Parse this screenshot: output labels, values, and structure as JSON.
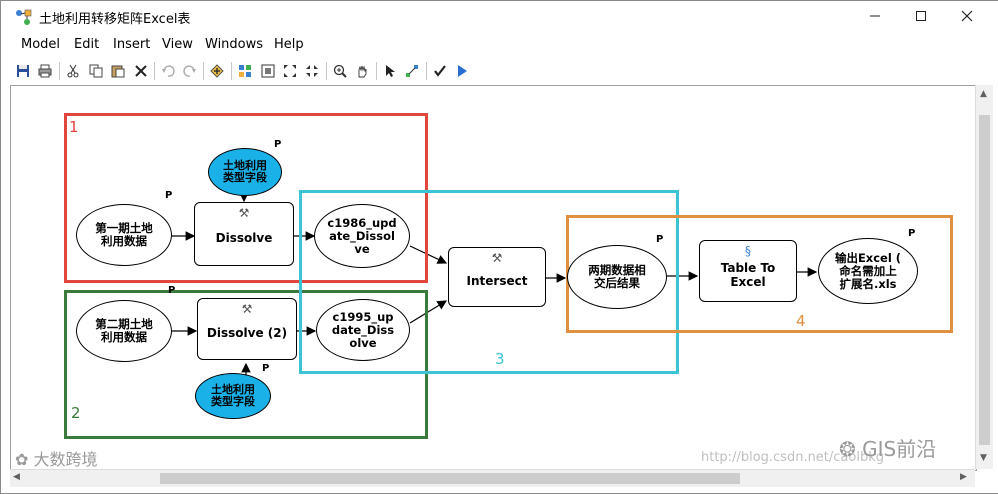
{
  "window": {
    "title": "土地利用转移矩阵Excel表",
    "minimize_icon": "minimize-icon",
    "maximize_icon": "maximize-icon",
    "close_icon": "close-icon"
  },
  "menu": [
    "Model",
    "Edit",
    "Insert",
    "View",
    "Windows",
    "Help"
  ],
  "toolbar": [
    "save-icon",
    "print-icon",
    "cut-icon",
    "copy-icon",
    "paste-icon",
    "delete-icon",
    "undo-icon",
    "redo-icon",
    "add-data-icon",
    "auto-layout-icon",
    "full-extent-icon",
    "zoom-in-fixed-icon",
    "zoom-out-fixed-icon",
    "zoom-in-icon",
    "pan-icon",
    "select-icon",
    "connect-icon",
    "validate-icon",
    "run-icon"
  ],
  "groups": [
    {
      "label": "1",
      "color": "#e0463c"
    },
    {
      "label": "2",
      "color": "#3a7a3a"
    },
    {
      "label": "3",
      "color": "#3cc4d4"
    },
    {
      "label": "4",
      "color": "#e09040"
    }
  ],
  "nodes": {
    "input1": "第一期土地\n利用数据",
    "field1": "土地利用\n类型字段",
    "dissolve1": "Dissolve",
    "output1": "c1986_upd\nate_Dissol\nve",
    "input2": "第二期土地\n利用数据",
    "field2": "土地利用\n类型字段",
    "dissolve2": "Dissolve (2)",
    "output2": "c1995_up\ndate_Diss\nolve",
    "intersect": "Intersect",
    "intersect_out": "两期数据相\n交后结果",
    "table_to_excel": "Table To\nExcel",
    "excel_out": "输出Excel (\n命名需加上\n扩展名.xls"
  },
  "p_marker": "P",
  "watermarks": {
    "bottom_left": "大数跨境",
    "bottom_right": "GIS前沿",
    "url": "http://blog.csdn.net/caolbkg"
  },
  "colors": {
    "ellipse_blue": "#1ab0e8",
    "group1": "#e0463c",
    "group2": "#3a7a3a",
    "group3": "#3cc4d4",
    "group4": "#e09040"
  }
}
